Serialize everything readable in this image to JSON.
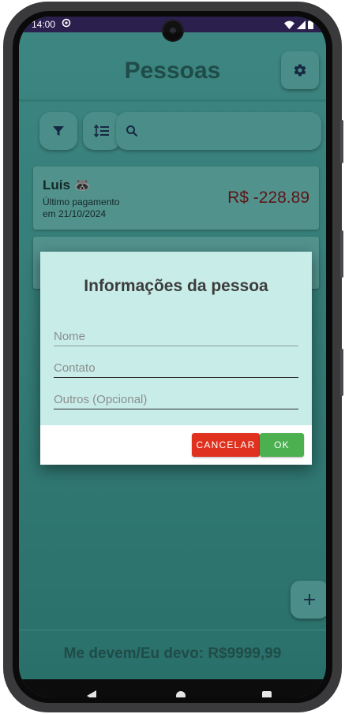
{
  "status_bar": {
    "time": "14:00"
  },
  "header": {
    "title": "Pessoas"
  },
  "people": [
    {
      "name": "Luis 🦝",
      "subtitle_line1": "Último pagamento",
      "subtitle_line2": "em 21/10/2024",
      "amount": "R$ -228.89"
    }
  ],
  "dialog": {
    "title": "Informações da pessoa",
    "fields": [
      {
        "placeholder": "Nome",
        "value": ""
      },
      {
        "placeholder": "Contato",
        "value": ""
      },
      {
        "placeholder": "Outros (Opcional)",
        "value": ""
      }
    ],
    "cancel_label": "CANCELAR",
    "ok_label": "OK"
  },
  "footer": {
    "summary": "Me devem/Eu devo: R$9999,99"
  },
  "colors": {
    "accent": "#6fd2ca",
    "negative_amount": "#8a1f1f",
    "cancel": "#e0301e",
    "ok": "#4caf50"
  },
  "icons": [
    "settings-gear-icon",
    "filter-icon",
    "sort-icon",
    "search-icon",
    "plus-icon",
    "nav-back-icon",
    "nav-home-icon",
    "nav-recents-icon"
  ]
}
